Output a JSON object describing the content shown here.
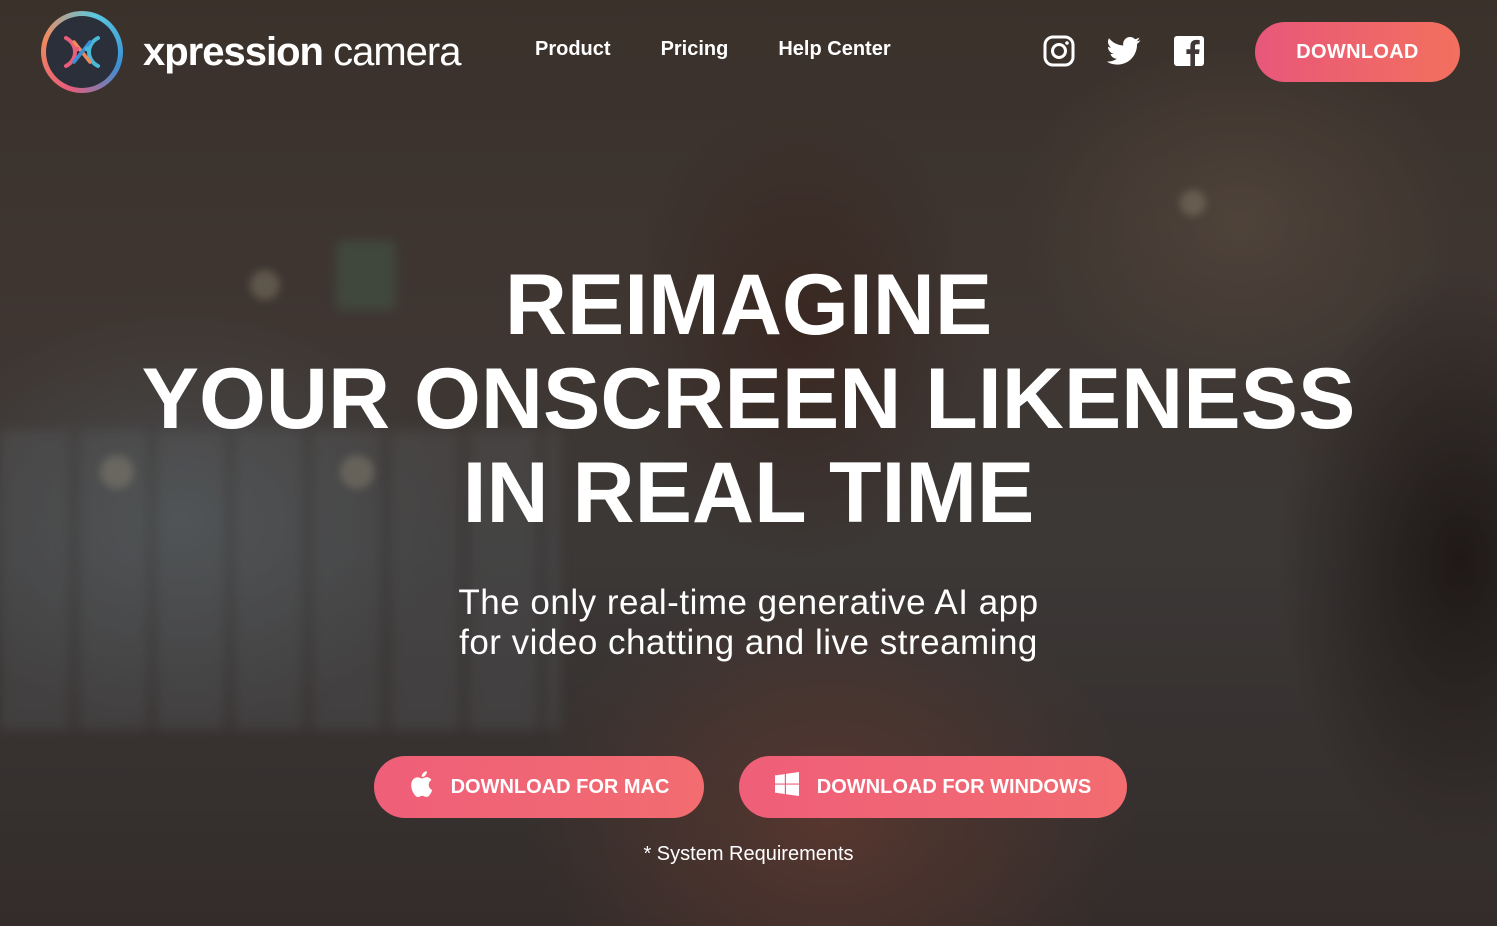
{
  "brand": {
    "name_bold": "xpression",
    "name_rest": " camera",
    "logo_icon": "xpression-logo-icon"
  },
  "nav": {
    "items": [
      {
        "label": "Product"
      },
      {
        "label": "Pricing"
      },
      {
        "label": "Help Center"
      }
    ]
  },
  "social": {
    "icons": [
      "instagram-icon",
      "twitter-icon",
      "facebook-icon"
    ]
  },
  "header_download": {
    "label": "DOWNLOAD"
  },
  "hero": {
    "headline": [
      "REIMAGINE",
      "YOUR ONSCREEN LIKENESS",
      "IN REAL TIME"
    ],
    "subline": [
      "The only real-time generative AI app",
      "for video chatting and live streaming"
    ],
    "download_mac": {
      "label": "DOWNLOAD FOR MAC",
      "icon": "apple-icon"
    },
    "download_windows": {
      "label": "DOWNLOAD FOR WINDOWS",
      "icon": "windows-icon"
    },
    "system_requirements": "* System Requirements"
  },
  "colors": {
    "accent_start": "#e8577a",
    "accent_end": "#f3705e"
  }
}
